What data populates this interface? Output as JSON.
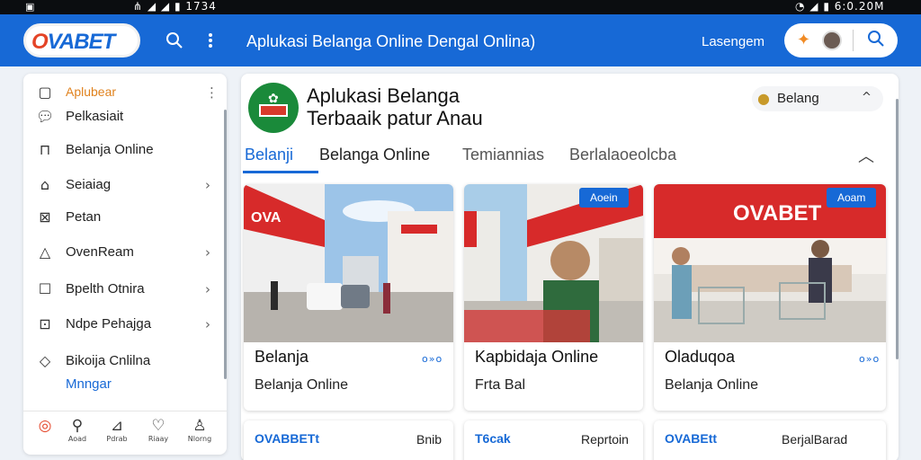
{
  "status_bar": {
    "left_icon": "screen-icon",
    "center_text": "⋔ ◢ ◢ ▮ 1734",
    "right_text": "◔ ◢ ▮ 6:0.20M"
  },
  "app_bar": {
    "logo_text": "OVABET",
    "title": "Aplukasi Belanga Online  Dengal Onlina)",
    "user_label": "Lasengem",
    "icons": [
      "search-icon",
      "more-vert-icon",
      "pin-icon",
      "avatar",
      "search-icon"
    ]
  },
  "sidebar": {
    "items": [
      {
        "icon": "square-icon",
        "label": "Aplubear",
        "chevron": false,
        "active": true
      },
      {
        "icon": "chat-icon",
        "label": "Pelkasiait",
        "chevron": false
      },
      {
        "icon": "lock-icon",
        "label": "Belanja Online",
        "chevron": false
      },
      {
        "icon": "share-icon",
        "label": "Seiaiag",
        "chevron": true
      },
      {
        "icon": "image-icon",
        "label": "Petan",
        "chevron": false
      },
      {
        "icon": "thumb-icon",
        "label": "OvenReam",
        "chevron": true
      },
      {
        "icon": "square-icon",
        "label": "Bpelth Otnira",
        "chevron": true
      },
      {
        "icon": "dots-icon",
        "label": "Ndpe Pehajga",
        "chevron": true
      },
      {
        "icon": "diamond-icon",
        "label": "Bikoija Cnlilna",
        "chevron": false
      }
    ],
    "sub_link": "Mnngar",
    "bottom_nav": [
      {
        "icon": "target-icon",
        "label": ""
      },
      {
        "icon": "user-icon",
        "label": "Aoad"
      },
      {
        "icon": "edit-icon",
        "label": "Pdrab"
      },
      {
        "icon": "heart-icon",
        "label": "Riaay"
      },
      {
        "icon": "person-icon",
        "label": "Nlorng"
      }
    ]
  },
  "hero": {
    "title_line1": "Aplukasi Belanga",
    "title_line2": "Terbaaik patur Anau",
    "chip_label": "Belang",
    "chip_caret": "^"
  },
  "tabs": [
    {
      "label": "Belanji",
      "active": true
    },
    {
      "label": "Belanga Online",
      "active": false
    },
    {
      "label": "Temiannias",
      "active": false
    },
    {
      "label": "Berlalaoeolcba",
      "active": false
    }
  ],
  "cards": [
    {
      "title": "Belanja",
      "subtitle": "Belanja Online",
      "more": "o»o",
      "badge": ""
    },
    {
      "title": "Kapbidaja Online",
      "subtitle": "Frta Bal",
      "more": "",
      "badge": "Aoein"
    },
    {
      "title": "Oladuqoa",
      "subtitle": "Belanja Online",
      "more": "o»o",
      "badge": "Aoam"
    }
  ],
  "bottom_cards": [
    {
      "brand": "OVABBETt",
      "right": "Bnib"
    },
    {
      "brand": "T6cak",
      "right": "Reprtoin"
    },
    {
      "brand": "OVABEtt",
      "right": "BerjalBarad"
    }
  ],
  "colors": {
    "primary": "#1769d6",
    "accent": "#e44427",
    "orange": "#e0821e",
    "green": "#1a8a3a"
  }
}
